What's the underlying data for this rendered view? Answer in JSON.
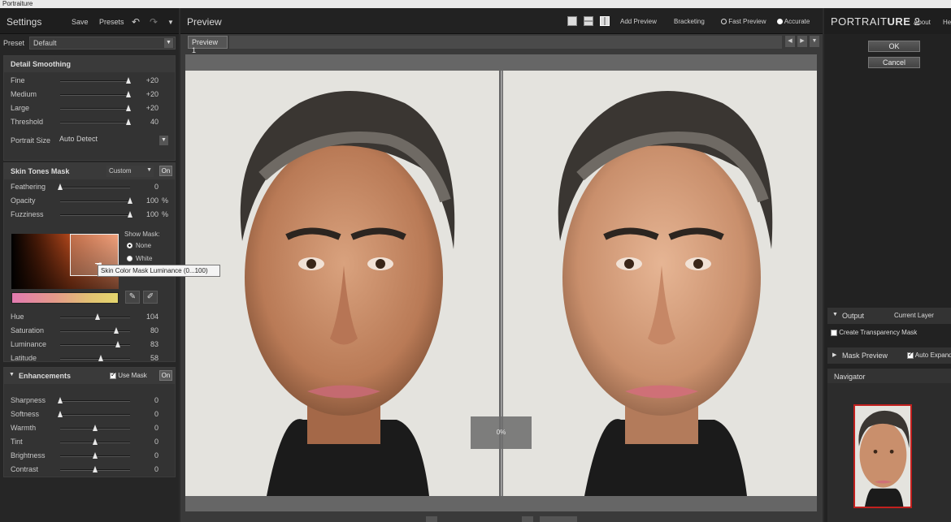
{
  "window": {
    "title": "Portraiture"
  },
  "left_panel": {
    "title": "Settings",
    "save_label": "Save",
    "presets_label": "Presets",
    "undo_icon": "undo-icon",
    "redo_icon": "redo-icon",
    "preset_label": "Preset",
    "preset_value": "Default",
    "detail_smoothing": {
      "header": "Detail Smoothing",
      "rows": [
        {
          "label": "Fine",
          "value": "+20",
          "pos": 0.98
        },
        {
          "label": "Medium",
          "value": "+20",
          "pos": 0.98
        },
        {
          "label": "Large",
          "value": "+20",
          "pos": 0.98
        },
        {
          "label": "Threshold",
          "value": "40",
          "pos": 0.98
        }
      ],
      "portrait_size_label": "Portrait Size",
      "portrait_size_value": "Auto Detect"
    },
    "skin_tones_mask": {
      "header": "Skin Tones Mask",
      "mode": "Custom",
      "on_label": "On",
      "rows": [
        {
          "label": "Feathering",
          "value": "0",
          "unit": "",
          "pos": 0.0
        },
        {
          "label": "Opacity",
          "value": "100",
          "unit": "%",
          "pos": 1.0
        },
        {
          "label": "Fuzziness",
          "value": "100",
          "unit": "%",
          "pos": 1.0
        }
      ],
      "show_mask_label": "Show Mask:",
      "radio_none": "None",
      "radio_white": "White",
      "tooltip": "Skin Color Mask Luminance (0...100)",
      "hsl_rows": [
        {
          "label": "Hue",
          "value": "104",
          "pos": 0.53
        },
        {
          "label": "Saturation",
          "value": "80",
          "pos": 0.8
        },
        {
          "label": "Luminance",
          "value": "83",
          "pos": 0.83
        },
        {
          "label": "Latitude",
          "value": "58",
          "pos": 0.58
        }
      ]
    },
    "enhancements": {
      "header": "Enhancements",
      "use_mask_label": "Use Mask",
      "on_label": "On",
      "rows": [
        {
          "label": "Sharpness",
          "value": "0",
          "pos": 0.0
        },
        {
          "label": "Softness",
          "value": "0",
          "pos": 0.0
        },
        {
          "label": "Warmth",
          "value": "0",
          "pos": 0.5
        },
        {
          "label": "Tint",
          "value": "0",
          "pos": 0.5
        },
        {
          "label": "Brightness",
          "value": "0",
          "pos": 0.5
        },
        {
          "label": "Contrast",
          "value": "0",
          "pos": 0.5
        }
      ]
    }
  },
  "center_panel": {
    "title": "Preview",
    "add_preview": "Add Preview",
    "bracketing": "Bracketing",
    "fast_preview": "Fast Preview",
    "accurate": "Accurate",
    "tab": "Preview 1",
    "progress": "0%"
  },
  "right_panel": {
    "logo_light": "PORTRAIT",
    "logo_bold": "URE",
    "logo_version": "2",
    "about": "About",
    "help": "Help",
    "ok": "OK",
    "cancel": "Cancel",
    "output_label": "Output",
    "output_value": "Current Layer",
    "create_transparency_mask": "Create Transparency Mask",
    "mask_preview": "Mask Preview",
    "auto_expand": "Auto Expand",
    "navigator": "Navigator"
  },
  "colors": {
    "nav_border": "#c2201e"
  }
}
